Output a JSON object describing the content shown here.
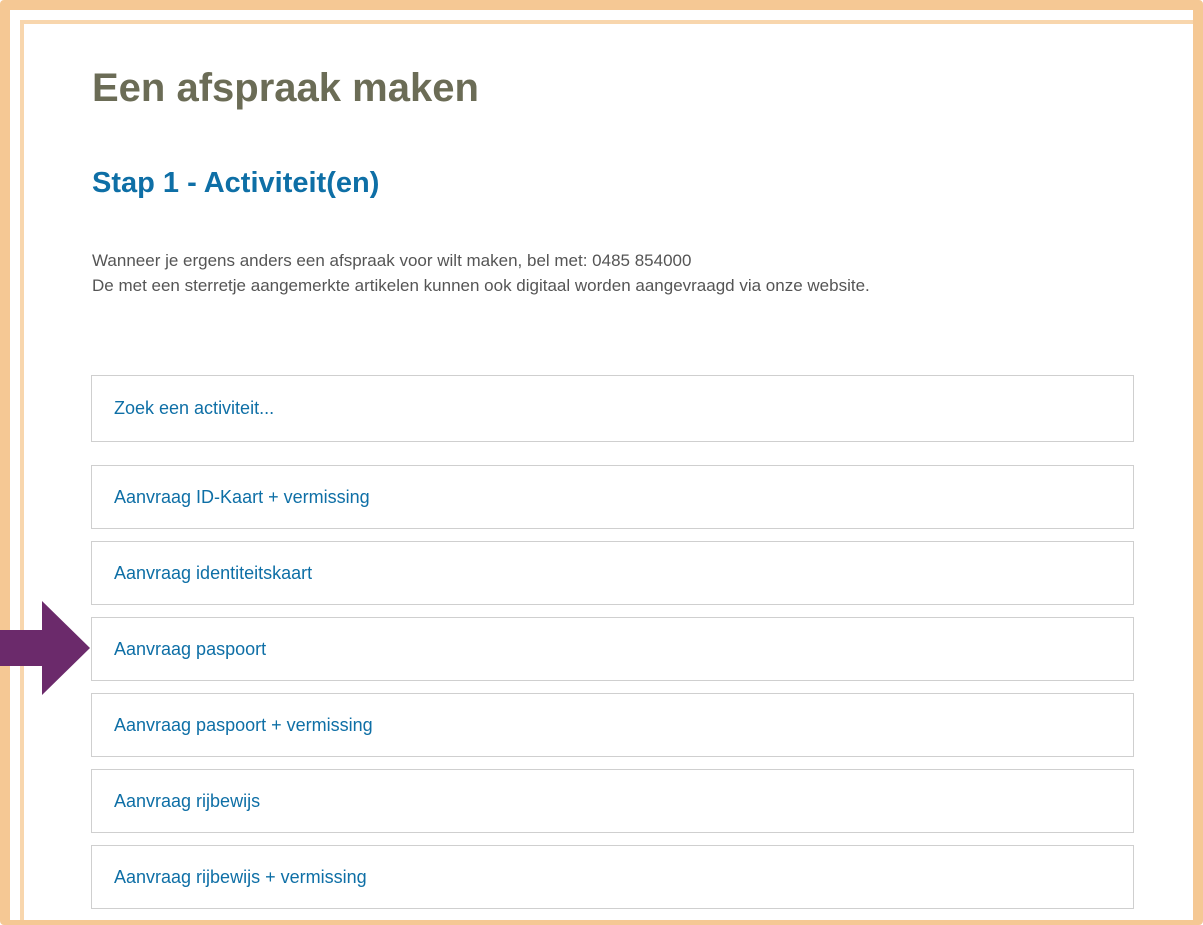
{
  "page": {
    "title": "Een afspraak maken",
    "step_title": "Stap 1 - Activiteit(en)",
    "intro_line_1": "Wanneer je ergens anders een afspraak voor wilt maken, bel met: 0485 854000",
    "intro_line_2": "De met een sterretje aangemerkte artikelen kunnen ook digitaal worden aangevraagd via onze website."
  },
  "search": {
    "placeholder": "Zoek een activiteit..."
  },
  "activities": [
    {
      "label": "Aanvraag ID-Kaart + vermissing"
    },
    {
      "label": "Aanvraag identiteitskaart"
    },
    {
      "label": "Aanvraag paspoort"
    },
    {
      "label": "Aanvraag paspoort + vermissing"
    },
    {
      "label": "Aanvraag rijbewijs"
    },
    {
      "label": "Aanvraag rijbewijs + vermissing"
    }
  ],
  "annotation": {
    "arrow_icon": "right-arrow-icon",
    "arrow_color": "#6b2a6b",
    "points_to": "Aanvraag paspoort"
  },
  "colors": {
    "frame": "#f5c894",
    "title": "#6b6c56",
    "accent": "#0e6fa6",
    "text": "#555555",
    "border": "#cfcfcf"
  }
}
